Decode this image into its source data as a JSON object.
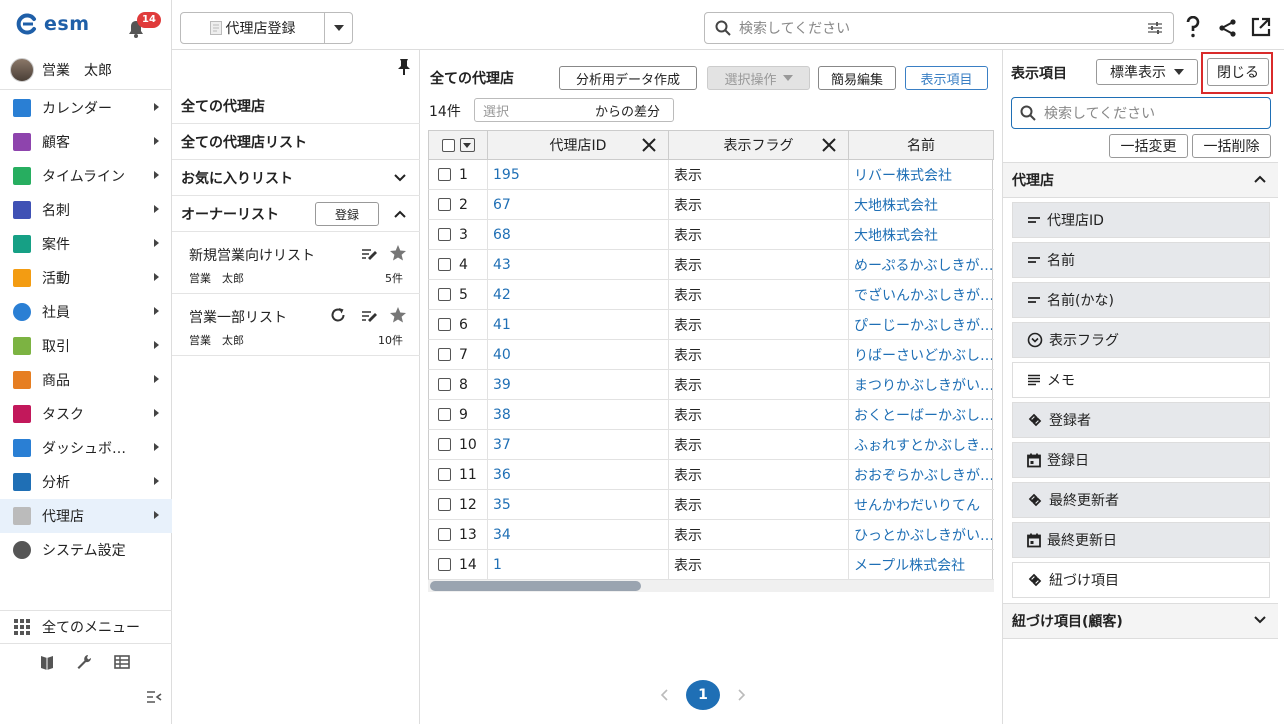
{
  "app": {
    "name": "esm",
    "notification_count": "14"
  },
  "user": {
    "name": "営業　太郎"
  },
  "sidebar": {
    "items": [
      {
        "label": "カレンダー",
        "icon": "calendar-icon",
        "color": "#2a7fd4"
      },
      {
        "label": "顧客",
        "icon": "building-icon",
        "color": "#8e44ad"
      },
      {
        "label": "タイムライン",
        "icon": "chat-icon",
        "color": "#27ae60"
      },
      {
        "label": "名刺",
        "icon": "card-icon",
        "color": "#3f51b5"
      },
      {
        "label": "案件",
        "icon": "folder-icon",
        "color": "#16a085"
      },
      {
        "label": "活動",
        "icon": "clipboard-icon",
        "color": "#f39c12"
      },
      {
        "label": "社員",
        "icon": "person-icon",
        "color": "#2a7fd4"
      },
      {
        "label": "取引",
        "icon": "book-icon",
        "color": "#7cb342"
      },
      {
        "label": "商品",
        "icon": "box-icon",
        "color": "#e67e22"
      },
      {
        "label": "タスク",
        "icon": "check-icon",
        "color": "#c2185b"
      },
      {
        "label": "ダッシュボ…",
        "icon": "dashboard-icon",
        "color": "#2a7fd4"
      },
      {
        "label": "分析",
        "icon": "chart-icon",
        "color": "#1f6fb5"
      },
      {
        "label": "代理店",
        "icon": "doc-icon",
        "color": "#bbbbbb"
      },
      {
        "label": "システム設定",
        "icon": "gear-icon",
        "color": "#555555"
      }
    ],
    "all_menu": "全てのメニュー"
  },
  "topbar": {
    "register_label": "代理店登録",
    "search_placeholder": "検索してください"
  },
  "lists": {
    "all": "全ての代理店",
    "all_lists": "全ての代理店リスト",
    "favorites": "お気に入りリスト",
    "owner": "オーナーリスト",
    "register": "登録",
    "entries": [
      {
        "title": "新規営業向けリスト",
        "owner": "営業　太郎",
        "count": "5件"
      },
      {
        "title": "営業一部リスト",
        "owner": "営業　太郎",
        "count": "10件"
      }
    ]
  },
  "main": {
    "title": "全ての代理店",
    "analysis_btn": "分析用データ作成",
    "select_op_btn": "選択操作",
    "quick_edit_btn": "簡易編集",
    "display_items_btn": "表示項目",
    "count": "14件",
    "diff_select": "選択",
    "diff_label": "からの差分",
    "columns": [
      "代理店ID",
      "表示フラグ",
      "名前"
    ],
    "rows": [
      {
        "no": "1",
        "id": "195",
        "flag": "表示",
        "name": "リバー株式会社"
      },
      {
        "no": "2",
        "id": "67",
        "flag": "表示",
        "name": "大地株式会社"
      },
      {
        "no": "3",
        "id": "68",
        "flag": "表示",
        "name": "大地株式会社"
      },
      {
        "no": "4",
        "id": "43",
        "flag": "表示",
        "name": "めーぷるかぶしきが…"
      },
      {
        "no": "5",
        "id": "42",
        "flag": "表示",
        "name": "でざいんかぶしきが…"
      },
      {
        "no": "6",
        "id": "41",
        "flag": "表示",
        "name": "ぴーじーかぶしきが…"
      },
      {
        "no": "7",
        "id": "40",
        "flag": "表示",
        "name": "りばーさいどかぶし…"
      },
      {
        "no": "8",
        "id": "39",
        "flag": "表示",
        "name": "まつりかぶしきがい…"
      },
      {
        "no": "9",
        "id": "38",
        "flag": "表示",
        "name": "おくとーばーかぶし…"
      },
      {
        "no": "10",
        "id": "37",
        "flag": "表示",
        "name": "ふぉれすとかぶしき…"
      },
      {
        "no": "11",
        "id": "36",
        "flag": "表示",
        "name": "おおぞらかぶしきが…"
      },
      {
        "no": "12",
        "id": "35",
        "flag": "表示",
        "name": "せんかわだいりてん"
      },
      {
        "no": "13",
        "id": "34",
        "flag": "表示",
        "name": "ひっとかぶしきがい…"
      },
      {
        "no": "14",
        "id": "1",
        "flag": "表示",
        "name": "メープル株式会社"
      }
    ],
    "page": "1"
  },
  "display_panel": {
    "title": "表示項目",
    "standard": "標準表示",
    "close": "閉じる",
    "search_placeholder": "検索してください",
    "bulk_change": "一括変更",
    "bulk_delete": "一括削除",
    "section": "代理店",
    "fields": [
      {
        "label": "代理店ID",
        "icon": "text-icon",
        "on": true
      },
      {
        "label": "名前",
        "icon": "text-icon",
        "on": true
      },
      {
        "label": "名前(かな)",
        "icon": "text-icon",
        "on": true
      },
      {
        "label": "表示フラグ",
        "icon": "dropdown-icon",
        "on": true
      },
      {
        "label": "メモ",
        "icon": "lines-icon",
        "on": false
      },
      {
        "label": "登録者",
        "icon": "link-icon",
        "on": true
      },
      {
        "label": "登録日",
        "icon": "calendar-icon",
        "on": true
      },
      {
        "label": "最終更新者",
        "icon": "link-icon",
        "on": true
      },
      {
        "label": "最終更新日",
        "icon": "calendar-icon",
        "on": true
      },
      {
        "label": "紐づけ項目",
        "icon": "link-icon",
        "on": false
      }
    ],
    "section2": "紐づけ項目(顧客)"
  }
}
